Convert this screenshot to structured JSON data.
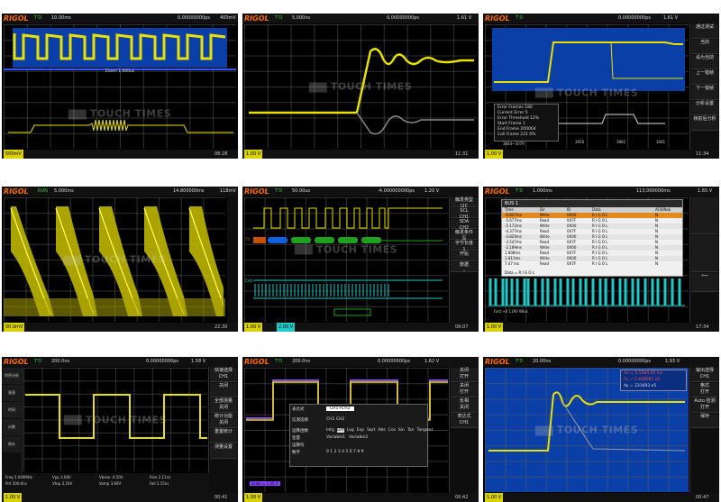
{
  "brand": "RIGOL",
  "watermark": "TOUCH TIMES",
  "colors": {
    "ch1": "#d8d000",
    "ch2": "#20c8c8",
    "math": "#8844ff",
    "zoom_bg": "#0a3fa8",
    "logo": "#ff6a00"
  },
  "panels": [
    {
      "id": "p1",
      "state": "T'D",
      "timebase": "10.00ms",
      "delay": "0.00000000ps",
      "trig": "400mV",
      "zoom_label": "Zoom 1.000us",
      "ch1_scale": "500mV",
      "time": "08:28"
    },
    {
      "id": "p2",
      "state": "T'D",
      "timebase": "5.000ns",
      "delay": "0.00000000ps",
      "trig": "1.61 V",
      "ch1_scale": "1.00 V",
      "time": "11:31"
    },
    {
      "id": "p3",
      "state": "T'D",
      "timebase": "",
      "delay": "0.00000000ps",
      "trig": "1.61 V",
      "ch1_scale": "1.00 V",
      "time": "11:34",
      "info": [
        "Error Frames 180",
        "Current Error 5",
        "Error Threshold 12%",
        "Start Frame 1",
        "End Frame 200064",
        "Coll Frame 231 0%"
      ],
      "left_readout": "3844~3079",
      "ticks": [
        "3956",
        "3881",
        "3081"
      ],
      "menu": [
        "通过测试",
        "当前",
        "设为当前",
        "上一错帧",
        "下一错帧",
        "分析设置",
        "帧前后分析"
      ]
    },
    {
      "id": "p4",
      "state": "RUN",
      "timebase": "5.000ms",
      "delay": "14.800000ms",
      "trig": "118mV",
      "ch1_scale": "50.0mV",
      "time": "22:30"
    },
    {
      "id": "p5",
      "state": "T'D",
      "timebase": "50.00us",
      "delay": "-4.000000000ps",
      "trig": "1.20 V",
      "ch1_scale": "1.00 V",
      "ch2_scale": "2.00 V",
      "time": "09:07",
      "decode_labels": [
        "TX",
        "CH2"
      ],
      "menu": [
        "触发类型",
        "I2C",
        "SCL",
        "CH1",
        "SDA",
        "CH2",
        "触发条件",
        "写",
        "字节长度",
        "1",
        "开始",
        "数据",
        "-"
      ]
    },
    {
      "id": "p6",
      "state": "T'D",
      "timebase": "1.000ms",
      "delay": "113.000000ms",
      "trig": "1.65 V",
      "ch1_scale": "1.00 V",
      "time": "17:34",
      "bus_title": "BUS 1",
      "cols": [
        "Time",
        "Dir",
        "ID",
        "Data",
        "ACK/Nak"
      ],
      "rows": [
        [
          "-6.847ms",
          "Write",
          "0X00",
          "R I G O L",
          "N"
        ],
        [
          "-5.677ms",
          "Read",
          "0X7F",
          "R I G O L",
          "N"
        ],
        [
          "-5.172ms",
          "Write",
          "0X00",
          "R I G O L",
          "N"
        ],
        [
          "-4.377ms",
          "Read",
          "0X7F",
          "R I G O L",
          "N"
        ],
        [
          "-3.829ms",
          "Write",
          "0X00",
          "R I G O L",
          "N"
        ],
        [
          "-3.547ms",
          "Read",
          "0X7F",
          "R I G O L",
          "N"
        ],
        [
          "-2.189ms",
          "Write",
          "0X00",
          "R I G O L",
          "N"
        ],
        [
          "1.808ms",
          "Read",
          "0X7F",
          "R I G O L",
          "N"
        ],
        [
          "1.811ms",
          "Write",
          "0X00",
          "R I G O L",
          "N"
        ],
        [
          "7.47 ms",
          "Read",
          "0X7F",
          "R I G O L",
          "N"
        ]
      ],
      "data_line": "Data = R I G O L",
      "foot": "Fast:+0.1190 98us"
    },
    {
      "id": "p7",
      "state": "T'D",
      "timebase": "200.0ns",
      "delay": "0.00000000ps",
      "trig": "1.58 V",
      "ch1_scale": "1.00 V",
      "time": "00:41",
      "left_menu": [
        "时序分析",
        "垂直",
        "时间",
        "计数",
        "统计"
      ],
      "menu": [
        "快速选择",
        "CH1",
        "关闭",
        "全部测量",
        "关闭",
        "统计功能",
        "关闭",
        "重置统计",
        "测量设置"
      ],
      "measurements": [
        "Freq 5.000MHz",
        "Prd 200.0ns",
        "Vpp 3.68V",
        "Vtop 3.16V",
        "Vbase -0.50V",
        "Vamp 3.66V",
        "Rise 2.11ns",
        "Fall 2.15ns"
      ]
    },
    {
      "id": "p8",
      "state": "T'D",
      "timebase": "200.0ns",
      "delay": "0.00000000ps",
      "trig": "1.62 V",
      "ch1_scale": "1.00 V",
      "time": "00:42",
      "dialog": {
        "title_label": "表达式",
        "title_value": "CH1+CH2",
        "source_label": "信源选择",
        "source_value": "CH1 CH2",
        "func_label": "运算函数",
        "funcs": [
          "Intg",
          "Diff",
          "Log",
          "Exp",
          "Sqrt",
          "Abs",
          "Cos",
          "Sin",
          "Tan",
          "Tangent"
        ],
        "var_label": "变量",
        "vars": [
          "Variable1",
          "Variable2"
        ],
        "op_label": "运算符",
        "digits_label": "数字",
        "digits": "0 1 2 3 4 5 6 7 8 9"
      },
      "math_label": "Scale = 1.00 V",
      "menu": [
        "",
        "关闭",
        "打开",
        "关闭",
        "打开",
        "反相",
        "关闭",
        "表达式",
        "CH1"
      ]
    },
    {
      "id": "p9",
      "state": "T'D",
      "timebase": "20.00ns",
      "delay": "0.00000000ps",
      "trig": "1.93 V",
      "ch1_scale": "1.00 V",
      "time": "00:47",
      "readouts": [
        "Ax = 5.1584 45 ms",
        "Fx = 1.438061 e5",
        "Ay = 231693 e5"
      ],
      "menu": [
        "输出选择",
        "CH1",
        "格式",
        "打开",
        "Auto 检测",
        "打开",
        "保存"
      ]
    }
  ]
}
